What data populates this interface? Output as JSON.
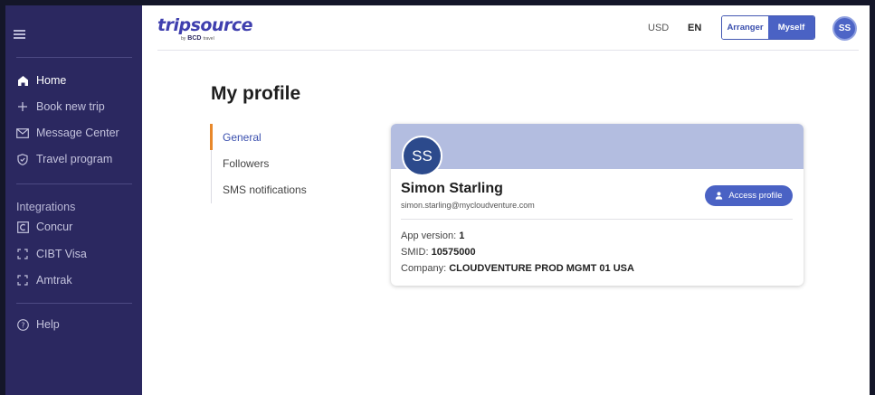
{
  "sidebar": {
    "nav": [
      {
        "label": "Home",
        "icon": "home-icon"
      },
      {
        "label": "Book new trip",
        "icon": "plus-icon"
      },
      {
        "label": "Message Center",
        "icon": "mail-icon"
      },
      {
        "label": "Travel program",
        "icon": "shield-icon"
      }
    ],
    "integrations_title": "Integrations",
    "integrations": [
      {
        "label": "Concur",
        "icon": "concur-icon"
      },
      {
        "label": "CIBT Visa",
        "icon": "bracket-icon"
      },
      {
        "label": "Amtrak",
        "icon": "bracket-icon"
      }
    ],
    "help": {
      "label": "Help",
      "icon": "help-icon"
    }
  },
  "header": {
    "logo_main": "tripsource",
    "logo_by": "by",
    "logo_bcd": "BCD",
    "logo_travel": "travel",
    "currency": "USD",
    "language": "EN",
    "toggle": {
      "arranger": "Arranger",
      "myself": "Myself",
      "active": "Myself"
    },
    "avatar_initials": "SS"
  },
  "page": {
    "title": "My profile",
    "tabs": [
      "General",
      "Followers",
      "SMS notifications"
    ],
    "active_tab": "General"
  },
  "profile": {
    "initials": "SS",
    "name": "Simon Starling",
    "email": "simon.starling@mycloudventure.com",
    "access_button": "Access profile",
    "app_version_label": "App version: ",
    "app_version": "1",
    "smid_label": "SMID: ",
    "smid": "10575000",
    "company_label": "Company: ",
    "company": "CLOUDVENTURE PROD MGMT 01 USA"
  },
  "colors": {
    "sidebar_bg": "#2b2860",
    "accent": "#4a62c4",
    "tab_indicator": "#e8882b",
    "banner": "#b3bde0"
  }
}
